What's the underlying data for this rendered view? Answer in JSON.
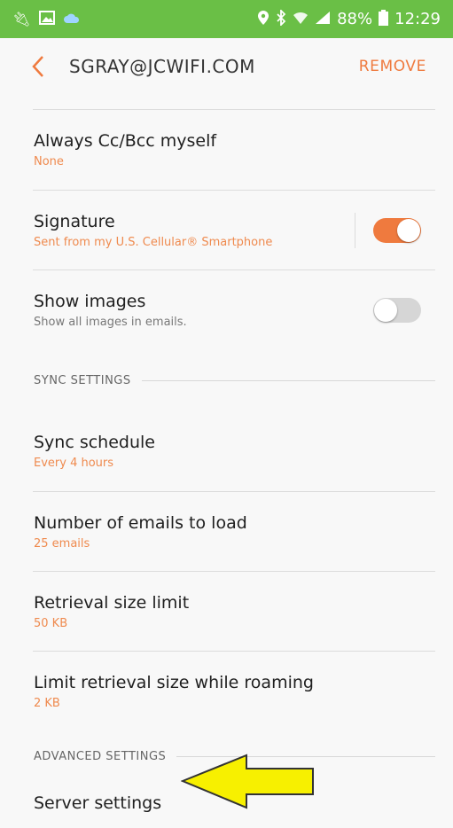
{
  "status_bar": {
    "time": "12:29",
    "battery": "88%",
    "left_icons": [
      "usb-icon",
      "image-icon",
      "cloud-icon"
    ],
    "right_icons": [
      "location-icon",
      "bluetooth-icon",
      "wifi-icon",
      "signal-icon",
      "battery-icon"
    ]
  },
  "header": {
    "account": "SGRAY@JCWIFI.COM",
    "remove_label": "REMOVE"
  },
  "settings": {
    "cc": {
      "title": "Always Cc/Bcc myself",
      "value": "None"
    },
    "signature": {
      "title": "Signature",
      "value": "Sent from my U.S. Cellular® Smartphone",
      "enabled": true
    },
    "show_images": {
      "title": "Show images",
      "value": "Show all images in emails.",
      "enabled": false
    }
  },
  "sync": {
    "heading": "SYNC SETTINGS",
    "schedule": {
      "title": "Sync schedule",
      "value": "Every 4 hours"
    },
    "emails_to_load": {
      "title": "Number of emails to load",
      "value": "25 emails"
    },
    "retrieval_limit": {
      "title": "Retrieval size limit",
      "value": "50 KB"
    },
    "roaming_limit": {
      "title": "Limit retrieval size while roaming",
      "value": "2 KB"
    }
  },
  "advanced": {
    "heading": "ADVANCED SETTINGS",
    "server": {
      "title": "Server settings"
    }
  },
  "colors": {
    "status_bar": "#6abf46",
    "accent": "#ef7a3e",
    "arrow": "#f7f000"
  }
}
